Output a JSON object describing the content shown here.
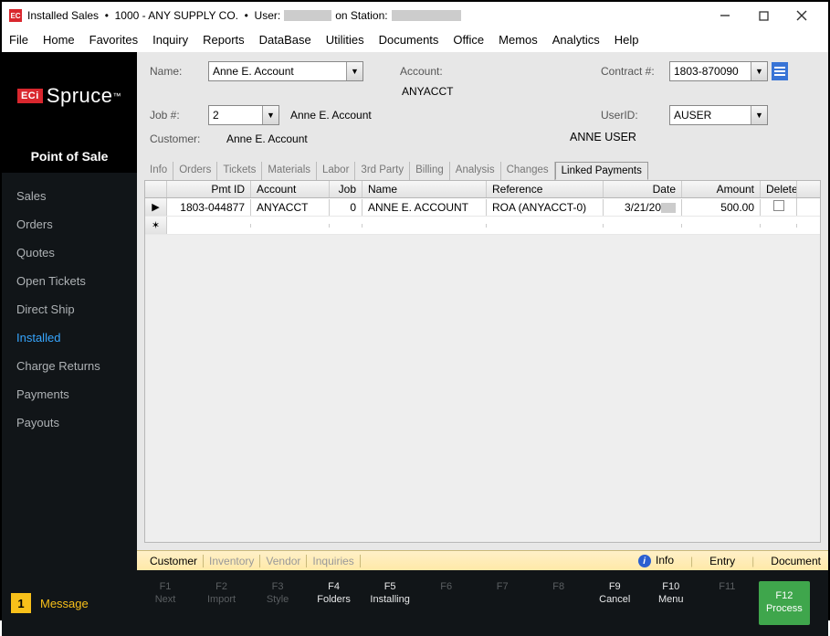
{
  "window": {
    "app": "Installed Sales",
    "company": "1000 - ANY SUPPLY CO.",
    "user_prefix": "User:",
    "station_prefix": "on Station:"
  },
  "menu": [
    "File",
    "Home",
    "Favorites",
    "Inquiry",
    "Reports",
    "DataBase",
    "Utilities",
    "Documents",
    "Office",
    "Memos",
    "Analytics",
    "Help"
  ],
  "sidebar": {
    "section": "Point of Sale",
    "items": [
      "Sales",
      "Orders",
      "Quotes",
      "Open Tickets",
      "Direct Ship",
      "Installed",
      "Charge Returns",
      "Payments",
      "Payouts"
    ],
    "active_index": 5
  },
  "form": {
    "name_label": "Name:",
    "name_value": "Anne E. Account",
    "account_label": "Account:",
    "account_value": "ANYACCT",
    "contract_label": "Contract #:",
    "contract_value": "1803-870090",
    "job_label": "Job #:",
    "job_value": "2",
    "job_display": "Anne E. Account",
    "userid_label": "UserID:",
    "userid_value": "AUSER",
    "customer_label": "Customer:",
    "customer_value": "Anne E. Account",
    "user_display": "ANNE USER"
  },
  "tabs": {
    "items": [
      "Info",
      "Orders",
      "Tickets",
      "Materials",
      "Labor",
      "3rd Party",
      "Billing",
      "Analysis",
      "Changes",
      "Linked Payments"
    ],
    "active_index": 9
  },
  "grid": {
    "columns": [
      "Pmt ID",
      "Account",
      "Job",
      "Name",
      "Reference",
      "Date",
      "Amount",
      "Delete"
    ],
    "row": {
      "pmt_id": "1803-044877",
      "account": "ANYACCT",
      "job": "0",
      "name": "ANNE E. ACCOUNT",
      "reference": "ROA (ANYACCT-0)",
      "date_prefix": "3/21/20",
      "amount": "500.00"
    }
  },
  "bottom_tabs": {
    "items": [
      "Customer",
      "Inventory",
      "Vendor",
      "Inquiries"
    ],
    "active_index": 0,
    "right": {
      "info": "Info",
      "entry": "Entry",
      "document": "Document"
    }
  },
  "footer": {
    "message_count": "1",
    "message_label": "Message",
    "keys": [
      {
        "f": "F1",
        "label": "Next",
        "enabled": false
      },
      {
        "f": "F2",
        "label": "Import",
        "enabled": false
      },
      {
        "f": "F3",
        "label": "Style",
        "enabled": false
      },
      {
        "f": "F4",
        "label": "Folders",
        "enabled": true
      },
      {
        "f": "F5",
        "label": "Installing",
        "enabled": true
      },
      {
        "f": "F6",
        "label": "",
        "enabled": false
      },
      {
        "f": "F7",
        "label": "",
        "enabled": false
      },
      {
        "f": "F8",
        "label": "",
        "enabled": false
      },
      {
        "f": "F9",
        "label": "Cancel",
        "enabled": true
      },
      {
        "f": "F10",
        "label": "Menu",
        "enabled": true
      },
      {
        "f": "F11",
        "label": "",
        "enabled": false
      },
      {
        "f": "F12",
        "label": "Process",
        "enabled": true,
        "process": true
      }
    ]
  }
}
